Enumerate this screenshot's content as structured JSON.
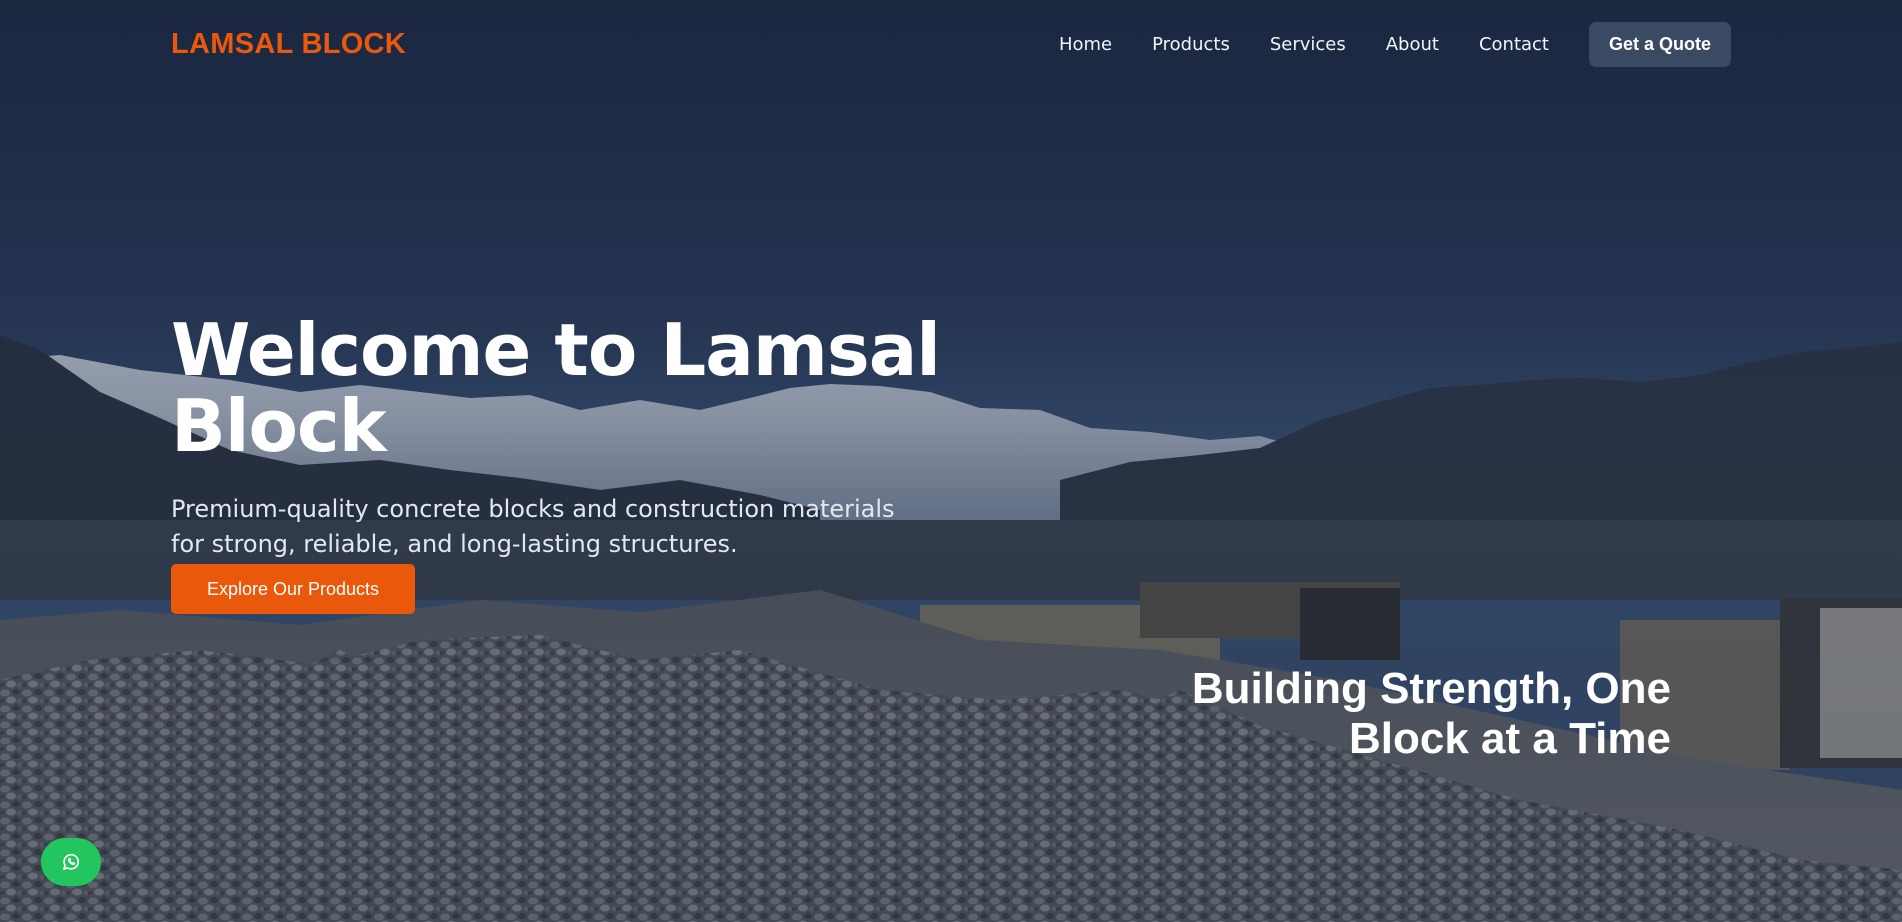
{
  "brand": {
    "logo_text": "LAMSAL BLOCK",
    "accent_color": "#ea580c"
  },
  "nav": {
    "links": [
      {
        "label": "Home"
      },
      {
        "label": "Products"
      },
      {
        "label": "Services"
      },
      {
        "label": "About"
      },
      {
        "label": "Contact"
      }
    ],
    "cta_label": "Get a Quote"
  },
  "hero": {
    "title": "Welcome to Lamsal Block",
    "subtitle": "Premium-quality concrete blocks and construction materials for strong, reliable, and long-lasting structures.",
    "cta_label": "Explore Our Products",
    "tagline": "Building Strength, One Block at a Time",
    "background_image": "mountain-and-gravel-construction-site"
  },
  "floating": {
    "whatsapp_icon": "whatsapp-icon",
    "whatsapp_color": "#22c55e"
  }
}
